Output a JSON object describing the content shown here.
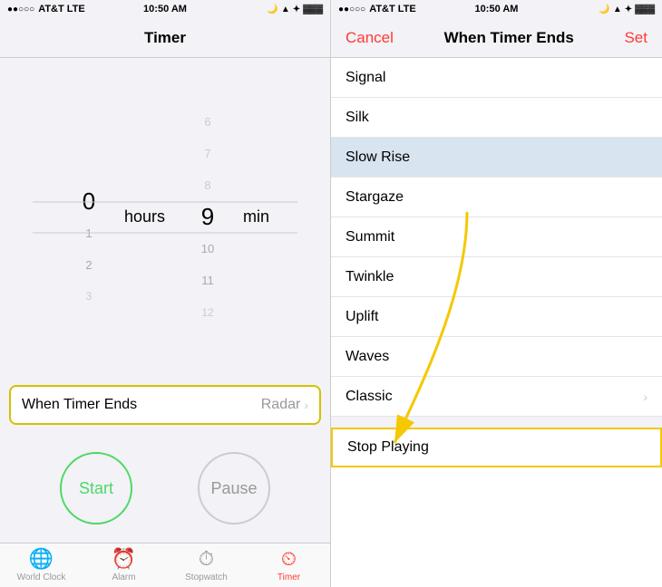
{
  "left": {
    "status": {
      "carrier": "AT&T  LTE",
      "time": "10:50 AM",
      "icons": "◀ ✦ ⬛"
    },
    "nav": {
      "title": "Timer"
    },
    "picker": {
      "hours_values": [
        "",
        "",
        "0",
        "1",
        "2",
        "3"
      ],
      "hours_label": "hours",
      "minutes_values": [
        "6",
        "7",
        "8",
        "9",
        "10",
        "11",
        "12"
      ],
      "minutes_label": "min"
    },
    "when_timer_ends": {
      "label": "When Timer Ends",
      "value": "Radar"
    },
    "buttons": {
      "start": "Start",
      "pause": "Pause"
    },
    "tabs": [
      {
        "id": "world-clock",
        "label": "World Clock",
        "icon": "🌐",
        "active": false
      },
      {
        "id": "alarm",
        "label": "Alarm",
        "icon": "⏰",
        "active": false
      },
      {
        "id": "stopwatch",
        "label": "Stopwatch",
        "icon": "⏱",
        "active": false
      },
      {
        "id": "timer",
        "label": "Timer",
        "icon": "⏲",
        "active": true
      }
    ]
  },
  "right": {
    "status": {
      "carrier": "AT&T  LTE",
      "time": "10:50 AM"
    },
    "nav": {
      "cancel": "Cancel",
      "title": "When Timer Ends",
      "set": "Set"
    },
    "tones": [
      {
        "label": "Signal",
        "chevron": false
      },
      {
        "label": "Silk",
        "chevron": false
      },
      {
        "label": "Slow Rise",
        "chevron": false,
        "selected": true
      },
      {
        "label": "Stargaze",
        "chevron": false
      },
      {
        "label": "Summit",
        "chevron": false
      },
      {
        "label": "Twinkle",
        "chevron": false
      },
      {
        "label": "Uplift",
        "chevron": false
      },
      {
        "label": "Waves",
        "chevron": false
      },
      {
        "label": "Classic",
        "chevron": true
      }
    ],
    "stop_playing": {
      "label": "Stop Playing"
    },
    "arrow": {
      "color": "#f5c800"
    }
  }
}
